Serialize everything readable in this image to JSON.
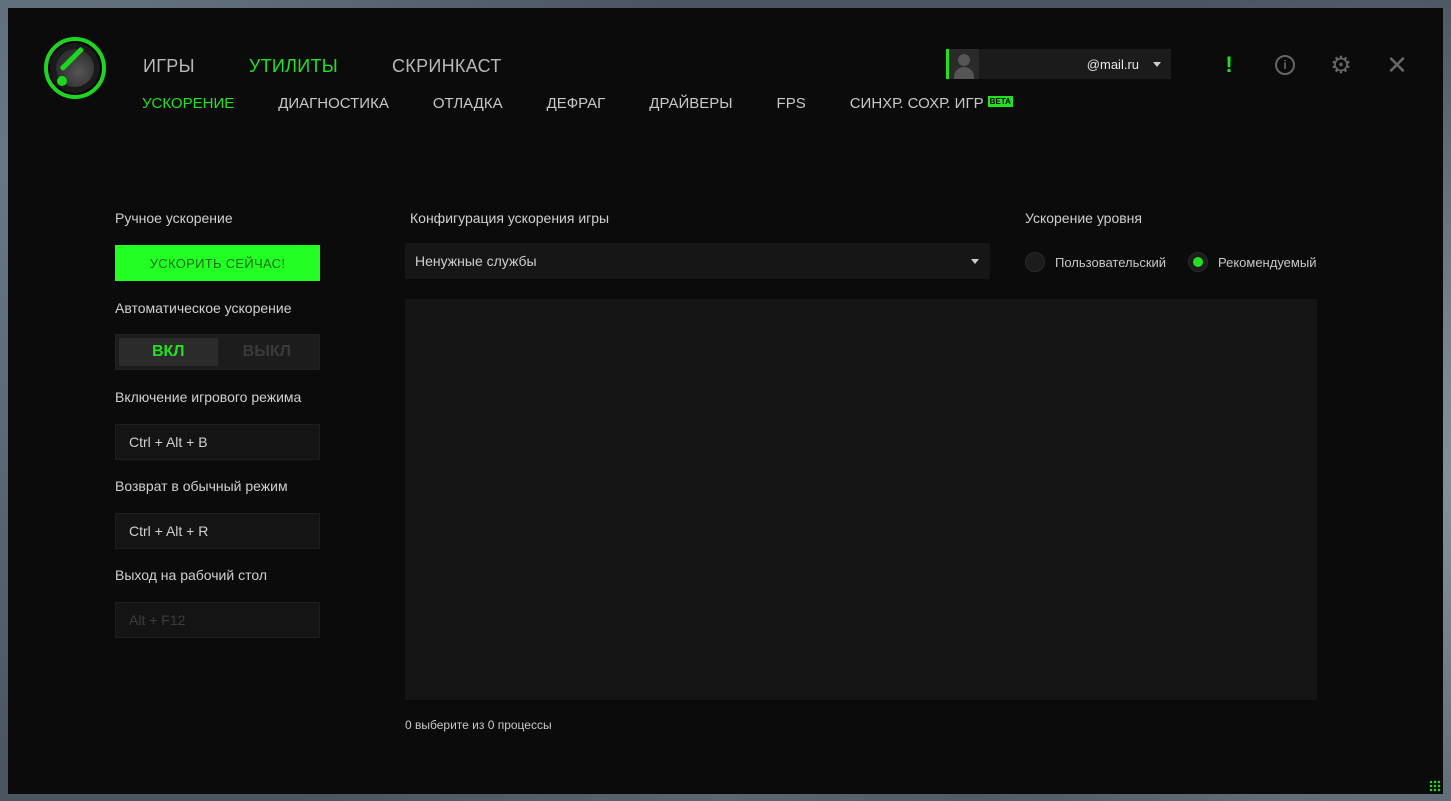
{
  "header": {
    "main_tabs": [
      {
        "label": "ИГРЫ"
      },
      {
        "label": "УТИЛИТЫ"
      },
      {
        "label": "СКРИНКАСТ"
      }
    ],
    "sub_tabs": [
      {
        "label": "УСКОРЕНИЕ"
      },
      {
        "label": "ДИАГНОСТИКА"
      },
      {
        "label": "ОТЛАДКА"
      },
      {
        "label": "ДЕФРАГ"
      },
      {
        "label": "ДРАЙВЕРЫ"
      },
      {
        "label": "FPS"
      },
      {
        "label": "СИНХР. СОХР. ИГР"
      }
    ],
    "beta_badge": "BETA",
    "account_email": "@mail.ru",
    "alert_glyph": "!",
    "info_glyph": "i",
    "gear_glyph": "⚙",
    "close_glyph": "✕"
  },
  "left": {
    "manual_label": "Ручное ускорение",
    "boost_button": "УСКОРИТЬ СЕЙЧАС!",
    "auto_label": "Автоматическое ускорение",
    "toggle_on": "ВКЛ",
    "toggle_off": "ВЫКЛ",
    "toggle_state": "on",
    "game_mode_label": "Включение игрового режима",
    "game_mode_hotkey": "Ctrl + Alt + B",
    "normal_mode_label": "Возврат в обычный режим",
    "normal_mode_hotkey": "Ctrl + Alt + R",
    "desktop_label": "Выход на рабочий стол",
    "desktop_hotkey": "Alt + F12"
  },
  "center": {
    "config_label": "Конфигурация ускорения игры",
    "config_selected": "Ненужные службы",
    "status_text": "0 выберите из 0 процессы"
  },
  "right": {
    "level_label": "Ускорение уровня",
    "option_custom": "Пользовательский",
    "option_recommended": "Рекомендуемый",
    "selected": "recommended"
  },
  "colors": {
    "accent": "#22e022",
    "background": "#0b0b0b"
  }
}
